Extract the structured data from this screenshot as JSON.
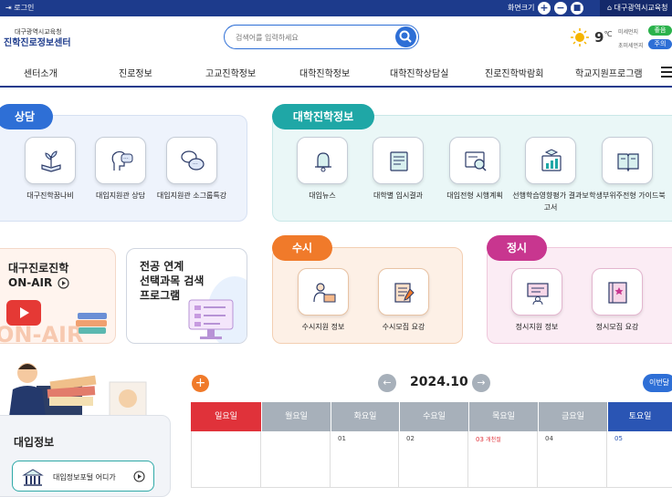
{
  "topbar": {
    "login": "로그인",
    "font_size_label": "화면크기",
    "org_link": "대구광역시교육청"
  },
  "header": {
    "logo_small": "대구광역시교육청",
    "logo_main": "진학진로정보센터",
    "search_placeholder": "검색어를 입력하세요",
    "temperature": "9",
    "temp_unit": "℃",
    "dust_label_1": "미세먼지",
    "dust_label_2": "초미세먼지",
    "badge_1": "좋음",
    "badge_2": "주의",
    "badge_colors": [
      "#2bb24c",
      "#2e6fd6"
    ]
  },
  "nav": {
    "items": [
      "센터소개",
      "진로정보",
      "고교진학정보",
      "대학진학정보",
      "대학진학상담실",
      "진로진학박람회",
      "학교지원프로그램"
    ]
  },
  "consult": {
    "tab": "상담",
    "items": [
      {
        "label": "대구진학꿈나비",
        "icon": "plant-book-icon"
      },
      {
        "label": "대입지원관 상담",
        "icon": "chat-head-icon"
      },
      {
        "label": "대입지원관 소그룹특강",
        "icon": "speech-bubbles-icon"
      }
    ]
  },
  "univinfo": {
    "tab": "대학진학정보",
    "items": [
      {
        "label": "대입뉴스",
        "icon": "bell-icon"
      },
      {
        "label": "대학별 입시결과",
        "icon": "document-icon"
      },
      {
        "label": "대입전형 시행계획",
        "icon": "search-document-icon"
      },
      {
        "label": "선행학습영향평가 결과보고서",
        "icon": "chart-graduation-icon"
      },
      {
        "label": "학생부위주전형 가이드북",
        "icon": "book-icon"
      }
    ]
  },
  "onair": {
    "line1": "대구진로진학",
    "line2": "ON-AIR",
    "bg_text": "ON-AIR"
  },
  "major": {
    "line1": "전공 연계",
    "line2": "선택과목 검색",
    "line3": "프로그램"
  },
  "susi": {
    "tab": "수시",
    "items": [
      {
        "label": "수시지원 정보",
        "icon": "person-laptop-icon"
      },
      {
        "label": "수시모집 요강",
        "icon": "notebook-pencil-icon"
      }
    ]
  },
  "jeongsi": {
    "tab": "정시",
    "items": [
      {
        "label": "정시지원 정보",
        "icon": "person-board-icon"
      },
      {
        "label": "정시모집 요강",
        "icon": "book-star-icon"
      }
    ]
  },
  "admission": {
    "title": "대입정보",
    "link": "대입정보포털 어디가"
  },
  "calendar": {
    "month": "2024.10",
    "this_month_btn": "이번달",
    "days": [
      "일요일",
      "월요일",
      "화요일",
      "수요일",
      "목요일",
      "금요일",
      "토요일"
    ],
    "head_colors": [
      "#e0323a",
      "#a7b0ba",
      "#a7b0ba",
      "#a7b0ba",
      "#a7b0ba",
      "#a7b0ba",
      "#2a55b4"
    ],
    "dates": [
      "",
      "",
      "01",
      "02",
      "03",
      "04",
      "05"
    ],
    "holiday_note": "개천절"
  },
  "colors": {
    "consult": "#2e6fd6",
    "univinfo": "#1fa7a6",
    "susi": "#f07a2a",
    "jeongsi": "#c8368f",
    "brand": "#1d3b8c"
  }
}
